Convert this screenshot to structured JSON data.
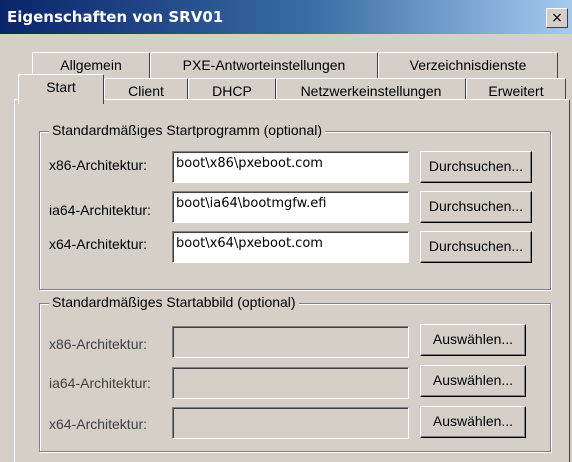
{
  "window": {
    "title": "Eigenschaften von SRV01",
    "close_label": "×"
  },
  "tabs": {
    "row_back": [
      {
        "label": "Allgemein"
      },
      {
        "label": "PXE-Antworteinstellungen"
      },
      {
        "label": "Verzeichnisdienste"
      }
    ],
    "row_front": [
      {
        "label": "Start",
        "active": true
      },
      {
        "label": "Client"
      },
      {
        "label": "DHCP"
      },
      {
        "label": "Netzwerkeinstellungen"
      },
      {
        "label": "Erweitert"
      }
    ]
  },
  "boot_program_group": {
    "legend": "Standardmäßiges Startprogramm (optional)",
    "rows": [
      {
        "label": "x86-Architektur:",
        "value": "boot\\x86\\pxeboot.com",
        "button": "Durchsuchen..."
      },
      {
        "label": "ia64-Architektur:",
        "value": "boot\\ia64\\bootmgfw.efi",
        "button": "Durchsuchen..."
      },
      {
        "label": "x64-Architektur:",
        "value": "boot\\x64\\pxeboot.com",
        "button": "Durchsuchen..."
      }
    ]
  },
  "boot_image_group": {
    "legend": "Standardmäßiges Startabbild (optional)",
    "rows": [
      {
        "label": "x86-Architektur:",
        "value": "",
        "button": "Auswählen..."
      },
      {
        "label": "ia64-Architektur:",
        "value": "",
        "button": "Auswählen..."
      },
      {
        "label": "x64-Architektur:",
        "value": "",
        "button": "Auswählen..."
      }
    ]
  }
}
